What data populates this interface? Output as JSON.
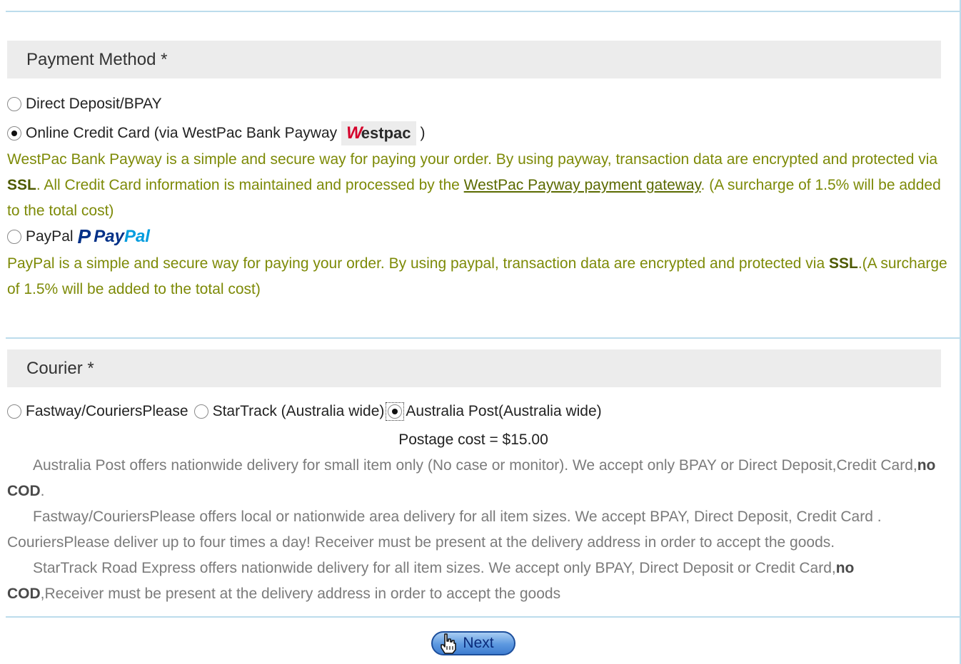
{
  "payment": {
    "heading": "Payment Method *",
    "options": [
      {
        "label": "Direct Deposit/BPAY",
        "checked": false
      },
      {
        "label": "Online Credit Card (via WestPac Bank Payway",
        "checked": true,
        "suffix": ")"
      },
      {
        "label": "PayPal",
        "checked": false
      }
    ],
    "westpac_logo_w": "W",
    "westpac_logo_text": "estpac",
    "westpac_desc": {
      "p1": "WestPac Bank Payway is a simple and secure way for paying your order. By using payway, transaction data are encrypted and protected via ",
      "ssl": "SSL",
      "p2": ". All Credit Card information is maintained and processed by the ",
      "link": "WestPac Payway payment gateway",
      "p3": ". (A surcharge of 1.5% will be added to the total cost)"
    },
    "paypal_logo": {
      "p": "P",
      "pay": "Pay",
      "pal": "Pal"
    },
    "paypal_desc": {
      "p1": "PayPal is a simple and secure way for paying your order. By using paypal, transaction data are encrypted and protected via ",
      "ssl": "SSL",
      "p2": ".(A surcharge of 1.5% will be added to the total cost)"
    }
  },
  "courier": {
    "heading": "Courier *",
    "options": [
      {
        "label": "Fastway/CouriersPlease",
        "checked": false
      },
      {
        "label": "StarTrack (Australia wide)",
        "checked": false
      },
      {
        "label": "Australia Post(Australia wide)",
        "checked": true
      }
    ],
    "postage": "Postage cost = $15.00",
    "notes": {
      "auspost_1": "Australia Post offers nationwide delivery for small item only (No case or monitor). We accept only BPAY or Direct Deposit,Credit Card,",
      "auspost_bold": "no COD",
      "auspost_2": ".",
      "fastway": "Fastway/CouriersPlease offers local or nationwide area delivery for all item sizes. We accept BPAY, Direct Deposit, Credit Card . CouriersPlease deliver up to four times a day! Receiver must be present at the delivery address in order to accept the goods.",
      "startrack_1": "StarTrack Road Express offers nationwide delivery for all item sizes. We accept only BPAY, Direct Deposit or Credit Card,",
      "startrack_bold": "no COD",
      "startrack_2": ",Receiver must be present at the delivery address in order to accept the goods"
    }
  },
  "next_button": {
    "label": "Next"
  },
  "colors": {
    "accent_line": "#bcdcec",
    "note_green": "#7d8a07",
    "westpac_red": "#d5002b",
    "paypal_blue": "#003087",
    "paypal_light": "#009cde"
  }
}
